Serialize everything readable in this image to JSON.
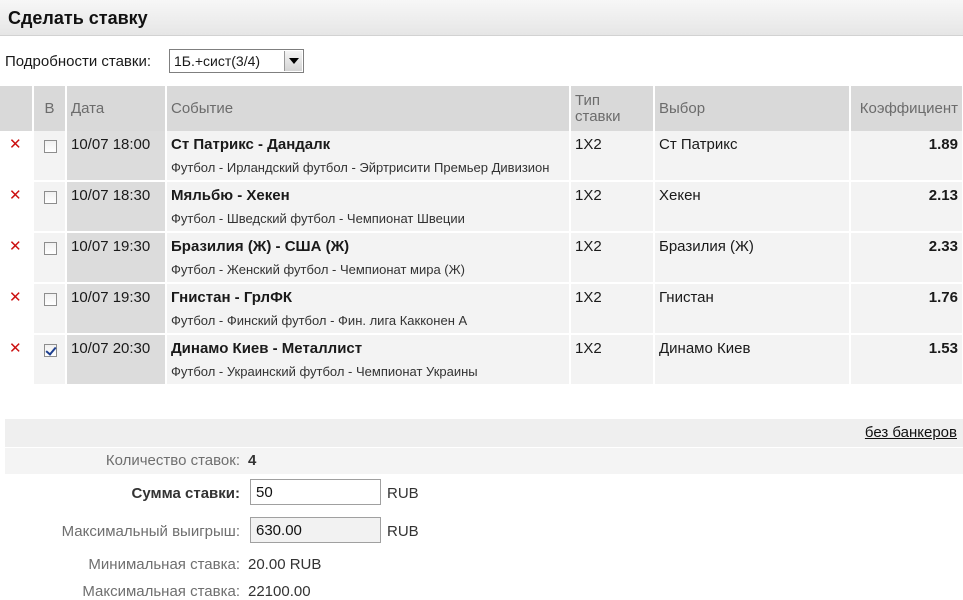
{
  "header": {
    "title": "Сделать ставку"
  },
  "details": {
    "label": "Подробности ставки:",
    "selected": "1Б.+сист(3/4)"
  },
  "table": {
    "headers": {
      "banker": "В",
      "date": "Дата",
      "event": "Событие",
      "bet_type": "Тип ставки",
      "choice": "Выбор",
      "coef": "Коэффициент"
    },
    "rows": [
      {
        "date": "10/07 18:00",
        "title": "Ст Патрикс - Дандалк",
        "sub": "Футбол - Ирландский футбол - Эйртрисити Премьер Дивизион",
        "type": "1X2",
        "choice": "Ст Патрикс",
        "coef": "1.89",
        "checked": false
      },
      {
        "date": "10/07 18:30",
        "title": "Мяльбю - Хекен",
        "sub": "Футбол - Шведский футбол - Чемпионат Швеции",
        "type": "1X2",
        "choice": "Хекен",
        "coef": "2.13",
        "checked": false
      },
      {
        "date": "10/07 19:30",
        "title": "Бразилия (Ж) - США (Ж)",
        "sub": "Футбол - Женский футбол - Чемпионат мира (Ж)",
        "type": "1X2",
        "choice": "Бразилия (Ж)",
        "coef": "2.33",
        "checked": false
      },
      {
        "date": "10/07 19:30",
        "title": "Гнистан - ГрлФК",
        "sub": "Футбол - Финский футбол - Фин. лига Какконен А",
        "type": "1X2",
        "choice": "Гнистан",
        "coef": "1.76",
        "checked": false
      },
      {
        "date": "10/07 20:30",
        "title": "Динамо Киев - Металлист",
        "sub": "Футбол - Украинский футбол - Чемпионат Украины",
        "type": "1X2",
        "choice": "Динамо Киев",
        "coef": "1.53",
        "checked": true
      }
    ]
  },
  "footer": {
    "no_bankers": "без банкеров",
    "bet_count_label": "Количество ставок:",
    "bet_count": "4",
    "stake_label": "Сумма ставки:",
    "stake_value": "50",
    "currency": "RUB",
    "max_win_label": "Максимальный выигрыш:",
    "max_win_value": "630.00",
    "min_stake_label": "Минимальная ставка:",
    "min_stake_value": "20.00 RUB",
    "max_stake_label": "Максимальная ставка:",
    "max_stake_value": "22100.00"
  },
  "colors": {
    "delete": "#cc1111",
    "header_bg": "#d9d9d9"
  }
}
